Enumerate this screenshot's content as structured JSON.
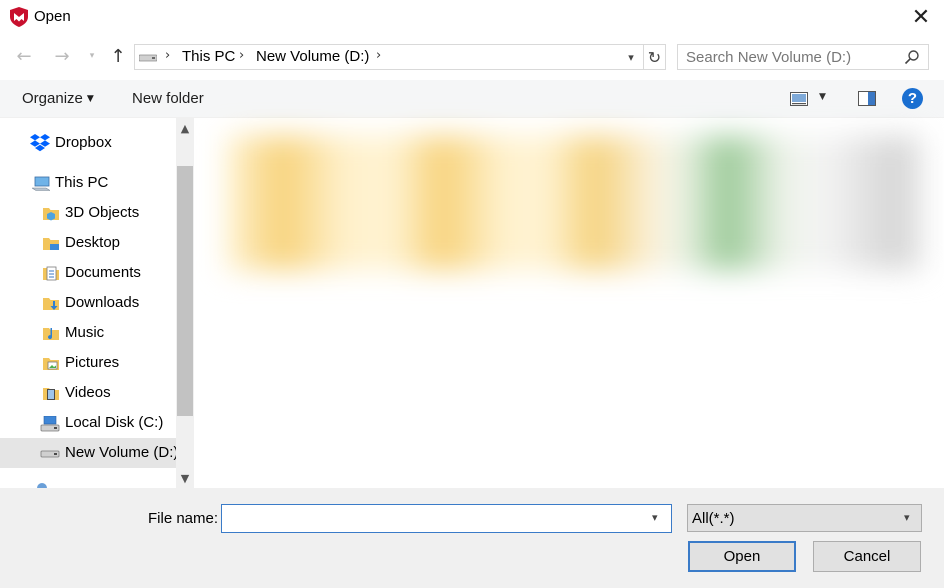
{
  "window": {
    "title": "Open"
  },
  "breadcrumb": [
    "This PC",
    "New Volume (D:)"
  ],
  "search": {
    "placeholder": "Search New Volume (D:)"
  },
  "toolbar": {
    "organize_label": "Organize",
    "new_folder_label": "New folder"
  },
  "sidebar": {
    "items": [
      {
        "label": "Dropbox",
        "icon": "dropbox-icon"
      },
      {
        "label": "This PC",
        "icon": "computer-icon"
      },
      {
        "label": "3D Objects",
        "icon": "3d-objects-folder-icon"
      },
      {
        "label": "Desktop",
        "icon": "desktop-folder-icon"
      },
      {
        "label": "Documents",
        "icon": "documents-folder-icon"
      },
      {
        "label": "Downloads",
        "icon": "downloads-folder-icon"
      },
      {
        "label": "Music",
        "icon": "music-folder-icon"
      },
      {
        "label": "Pictures",
        "icon": "pictures-folder-icon"
      },
      {
        "label": "Videos",
        "icon": "videos-folder-icon"
      },
      {
        "label": "Local Disk (C:)",
        "icon": "local-disk-icon"
      },
      {
        "label": "New Volume (D:)",
        "icon": "drive-icon",
        "selected": true
      }
    ]
  },
  "footer": {
    "filename_label": "File name:",
    "filename_value": "",
    "filter_value": "All(*.*)",
    "open_label": "Open",
    "cancel_label": "Cancel"
  },
  "colors": {
    "accent": "#3a7bc8",
    "help": "#1a6fd1",
    "app_icon": "#c8102e"
  }
}
